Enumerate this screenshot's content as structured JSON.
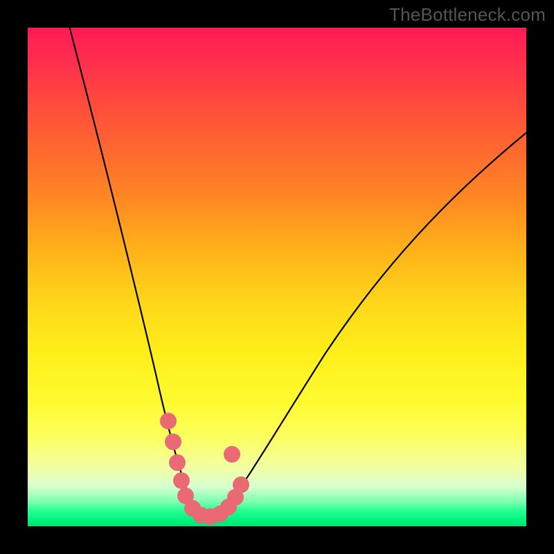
{
  "watermark": "TheBottleneck.com",
  "chart_data": {
    "type": "line",
    "title": "",
    "xlabel": "",
    "ylabel": "",
    "xlim": [
      0,
      100
    ],
    "ylim": [
      0,
      100
    ],
    "notes": "V-shaped bottleneck curve on red-to-green vertical gradient. Minimum near x≈34, y≈2. No axis ticks or numeric labels are shown in the image; x/y values below are normalized 0–100 estimates read off the plot.",
    "series": [
      {
        "name": "left-branch",
        "x": [
          8,
          12,
          16,
          20,
          24,
          27,
          30,
          32,
          34
        ],
        "y": [
          100,
          86,
          70,
          54,
          38,
          24,
          12,
          5,
          2
        ]
      },
      {
        "name": "right-branch",
        "x": [
          34,
          38,
          45,
          55,
          65,
          75,
          85,
          95,
          100
        ],
        "y": [
          2,
          4,
          12,
          27,
          42,
          55,
          66,
          75,
          79
        ]
      }
    ],
    "highlight_points": {
      "name": "lower-segment-dots",
      "color": "#e96a74",
      "points": [
        {
          "x": 27.5,
          "y": 20
        },
        {
          "x": 28.5,
          "y": 15
        },
        {
          "x": 29.5,
          "y": 10
        },
        {
          "x": 30.5,
          "y": 7
        },
        {
          "x": 31.5,
          "y": 5
        },
        {
          "x": 33.0,
          "y": 3
        },
        {
          "x": 34.5,
          "y": 2.5
        },
        {
          "x": 36.0,
          "y": 2.5
        },
        {
          "x": 37.5,
          "y": 3
        },
        {
          "x": 39.0,
          "y": 4
        },
        {
          "x": 40.5,
          "y": 6
        },
        {
          "x": 41.5,
          "y": 8
        },
        {
          "x": 40.0,
          "y": 14
        }
      ]
    }
  }
}
